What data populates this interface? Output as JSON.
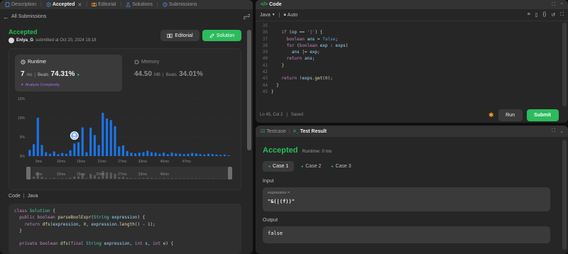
{
  "left_tabs": {
    "description": "Description",
    "accepted": "Accepted",
    "editorial": "Editorial",
    "solutions": "Solutions",
    "submissions": "Submissions"
  },
  "submission": {
    "back_label": "All Submissions",
    "status": "Accepted",
    "author": "Enlya_G",
    "submitted_text": "submitted at Oct 20, 2024 18:18",
    "editorial_btn": "Editorial",
    "solution_btn": "Solution"
  },
  "runtime": {
    "title": "Runtime",
    "value": "7",
    "unit": "ms",
    "beats_label": "Beats",
    "beats_value": "74.31%",
    "analyze_label": "Analyze Complexity"
  },
  "memory": {
    "title": "Memory",
    "value": "44.50",
    "unit": "MB",
    "beats_label": "Beats",
    "beats_value": "34.01%"
  },
  "chart_data": {
    "type": "bar",
    "y_ticks": [
      "15%",
      "10%",
      "5%",
      "0%"
    ],
    "ylim": [
      0,
      15
    ],
    "x_ticks": [
      "3ms",
      "10ms",
      "15ms",
      "21ms",
      "27ms",
      "33ms",
      "40ms",
      "47ms"
    ],
    "x_tick_positions": [
      2.2,
      7.7,
      12.6,
      17.8,
      22.8,
      27.8,
      33.2,
      38.6
    ],
    "mini_ticks": [
      "3ms",
      "10ms",
      "15ms",
      "20ms",
      "27ms",
      "33ms",
      "40ms"
    ],
    "values": [
      1.6,
      3.1,
      10,
      2.9,
      1.0,
      0.6,
      1.2,
      0.5,
      0.8,
      0.6,
      1.5,
      3.3,
      3.6,
      7.5,
      1.0,
      7.4,
      5.5,
      2.9,
      11.3,
      9.8,
      9.4,
      7.8,
      2.5,
      2.8,
      1.3,
      0.9,
      0.7,
      0.9,
      1.0,
      1.4,
      1.0,
      0.9,
      0.6,
      0.9,
      0.5,
      0.9,
      0.7,
      0.6,
      0.5,
      0.6,
      0.8,
      0.7,
      0.5,
      0.4,
      0.6,
      0.5,
      0.4,
      0.3,
      0.4,
      0.2
    ],
    "highlight_index": 11,
    "bar_color": "#1a74e8"
  },
  "code_section": {
    "title": "Code",
    "lang": "Java"
  },
  "left_code": [
    [
      [
        "kw",
        "class "
      ],
      [
        "ty",
        "Solution "
      ],
      [
        "op",
        "{"
      ]
    ],
    [
      [
        "kw",
        "  public boolean "
      ],
      [
        "fn",
        "parseBoolExpr"
      ],
      [
        "op",
        "("
      ],
      [
        "ty",
        "String "
      ],
      [
        "vr",
        "expression"
      ],
      [
        "op",
        ") {"
      ]
    ],
    [
      [
        "kw",
        "    return "
      ],
      [
        "fn",
        "dfs"
      ],
      [
        "op",
        "("
      ],
      [
        "vr",
        "expression"
      ],
      [
        "op",
        ", "
      ],
      [
        "num",
        "0"
      ],
      [
        "op",
        ", "
      ],
      [
        "vr",
        "expression"
      ],
      [
        "op",
        "."
      ],
      [
        "fn",
        "length"
      ],
      [
        "op",
        "() - "
      ],
      [
        "num",
        "1"
      ],
      [
        "op",
        ");"
      ]
    ],
    [
      [
        "op",
        "  }"
      ]
    ],
    [
      [
        "op",
        ""
      ]
    ],
    [
      [
        "kw",
        "  private boolean "
      ],
      [
        "fn",
        "dfs"
      ],
      [
        "op",
        "("
      ],
      [
        "kw",
        "final "
      ],
      [
        "ty",
        "String "
      ],
      [
        "vr",
        "expression"
      ],
      [
        "op",
        ", "
      ],
      [
        "kw",
        "int "
      ],
      [
        "vr",
        "s"
      ],
      [
        "op",
        ", "
      ],
      [
        "kw",
        "int "
      ],
      [
        "vr",
        "e"
      ],
      [
        "op",
        ") {"
      ]
    ]
  ],
  "editor": {
    "title": "Code",
    "lang": "Java",
    "mode": "Auto",
    "status_pos": "Ln 45, Col 2",
    "status_saved": "Saved",
    "run_btn": "Run",
    "submit_btn": "Submit",
    "lines": [
      {
        "n": "35",
        "t": [
          [
            "op",
            ""
          ]
        ]
      },
      {
        "n": "36",
        "t": [
          [
            "kw",
            "    if "
          ],
          [
            "op",
            "("
          ],
          [
            "vr",
            "op "
          ],
          [
            "op",
            "== "
          ],
          [
            "str",
            "'|'"
          ],
          [
            "op",
            ") {"
          ]
        ]
      },
      {
        "n": "37",
        "t": [
          [
            "kw",
            "      boolean "
          ],
          [
            "vr",
            "ans "
          ],
          [
            "op",
            "= "
          ],
          [
            "bl",
            "false"
          ],
          [
            "op",
            ";"
          ]
        ]
      },
      {
        "n": "38",
        "t": [
          [
            "kw",
            "      for "
          ],
          [
            "op",
            "("
          ],
          [
            "kw",
            "boolean "
          ],
          [
            "vr",
            "exp "
          ],
          [
            "op",
            ": "
          ],
          [
            "vr",
            "exps"
          ],
          [
            "op",
            ")"
          ]
        ]
      },
      {
        "n": "39",
        "t": [
          [
            "vr",
            "        ans "
          ],
          [
            "op",
            "|= "
          ],
          [
            "vr",
            "exp"
          ],
          [
            "op",
            ";"
          ]
        ]
      },
      {
        "n": "40",
        "t": [
          [
            "kw",
            "      return "
          ],
          [
            "vr",
            "ans"
          ],
          [
            "op",
            ";"
          ]
        ]
      },
      {
        "n": "41",
        "t": [
          [
            "op",
            "    }"
          ]
        ]
      },
      {
        "n": "42",
        "t": [
          [
            "op",
            ""
          ]
        ]
      },
      {
        "n": "43",
        "t": [
          [
            "kw",
            "    return "
          ],
          [
            "op",
            "!"
          ],
          [
            "vr",
            "exps"
          ],
          [
            "op",
            "."
          ],
          [
            "fn",
            "get"
          ],
          [
            "op",
            "("
          ],
          [
            "num",
            "0"
          ],
          [
            "op",
            ");"
          ]
        ]
      },
      {
        "n": "44",
        "t": [
          [
            "op",
            "  }"
          ]
        ]
      },
      {
        "n": "45",
        "t": [
          [
            "op",
            "}"
          ]
        ]
      }
    ]
  },
  "testpanel": {
    "testcase_tab": "Testcase",
    "result_tab": "Test Result",
    "status": "Accepted",
    "runtime_text": "Runtime: 0 ms",
    "cases": [
      "Case 1",
      "Case 2",
      "Case 3"
    ],
    "input_label": "Input",
    "input_var": "expression =",
    "input_value": "\"&(|(f))\"",
    "output_label": "Output",
    "output_value": "false"
  },
  "colors": {
    "accent_green": "#2cbb5d",
    "bar_blue": "#1a74e8",
    "accent_orange": "#ffa116"
  }
}
